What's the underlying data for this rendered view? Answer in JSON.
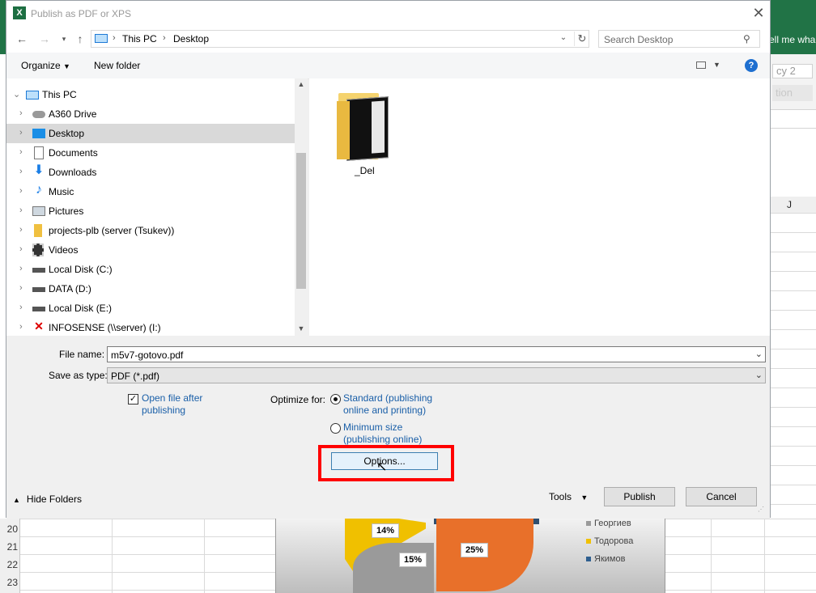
{
  "excel": {
    "tell_me": "ell me wha",
    "accent_label": "cy 2",
    "action_label": "tion",
    "col_j": "J",
    "rows": [
      "20",
      "21",
      "22",
      "23"
    ],
    "chart": {
      "pct_14": "14%",
      "pct_15": "15%",
      "pct_25": "25%",
      "legend": [
        {
          "name": "Георгиев",
          "color": "#9a9a9a"
        },
        {
          "name": "Тодорова",
          "color": "#f0c000"
        },
        {
          "name": "Якимов",
          "color": "#2f5f8f"
        }
      ]
    }
  },
  "dialog": {
    "title": "Publish as PDF or XPS",
    "title_icon": "X",
    "address": {
      "segments": [
        "This PC",
        "Desktop"
      ]
    },
    "search": {
      "placeholder": "Search Desktop"
    },
    "toolbar": {
      "organize": "Organize",
      "new_folder": "New folder"
    },
    "tree": [
      {
        "label": "This PC",
        "icon": "pc-icon",
        "expanded": true
      },
      {
        "label": "A360 Drive",
        "icon": "cloud-drive-icon"
      },
      {
        "label": "Desktop",
        "icon": "desktop-icon",
        "selected": true
      },
      {
        "label": "Documents",
        "icon": "documents-icon"
      },
      {
        "label": "Downloads",
        "icon": "downloads-icon"
      },
      {
        "label": "Music",
        "icon": "music-icon"
      },
      {
        "label": "Pictures",
        "icon": "pictures-icon"
      },
      {
        "label": "projects-plb (server (Tsukev))",
        "icon": "network-drive-icon"
      },
      {
        "label": "Videos",
        "icon": "videos-icon"
      },
      {
        "label": "Local Disk (C:)",
        "icon": "disk-icon"
      },
      {
        "label": "DATA (D:)",
        "icon": "disk-icon"
      },
      {
        "label": "Local Disk (E:)",
        "icon": "disk-icon"
      },
      {
        "label": "INFOSENSE (\\\\server) (I:)",
        "icon": "disconnected-drive-icon"
      }
    ],
    "files": [
      {
        "name": "_Del",
        "icon": "folder-icon"
      }
    ],
    "form": {
      "file_name_label": "File name:",
      "file_name_value": "m5v7-gotovo.pdf",
      "save_type_label": "Save as type:",
      "save_type_value": "PDF (*.pdf)",
      "open_after_line1": "Open file after",
      "open_after_line2": "publishing",
      "open_after_checked": true,
      "optimize_label": "Optimize for:",
      "standard_line1": "Standard (publishing",
      "standard_line2": "online and printing)",
      "minimum_line1": "Minimum size",
      "minimum_line2": "(publishing online)",
      "options_button": "Options..."
    },
    "footer": {
      "hide_folders": "Hide Folders",
      "tools": "Tools",
      "publish": "Publish",
      "cancel": "Cancel"
    }
  }
}
